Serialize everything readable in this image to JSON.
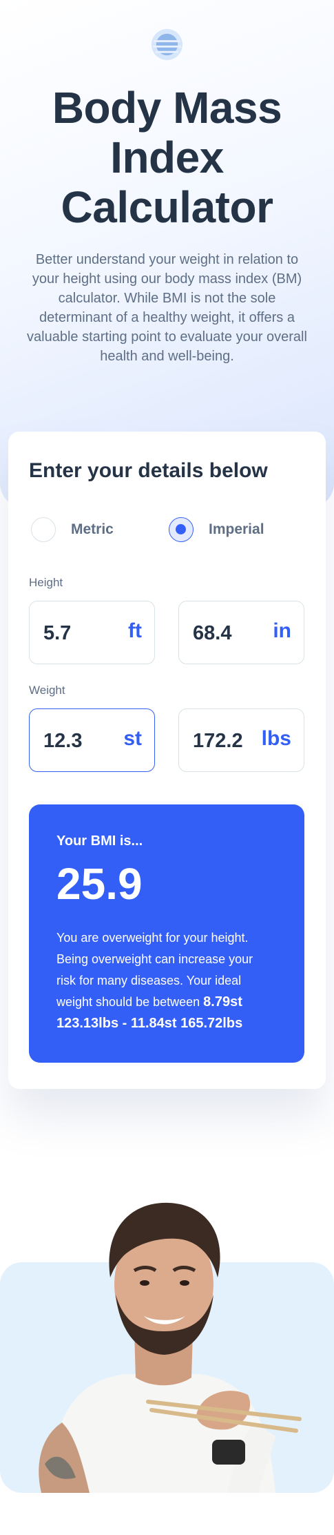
{
  "header": {
    "logo_icon": "logo-icon",
    "title": "Body Mass Index Calculator",
    "intro": "Better understand your weight in relation to your height using our body mass index (BM) calculator. While BMI is not the sole determinant of a healthy weight, it offers a valuable starting point to evaluate your overall health and well-being."
  },
  "form": {
    "heading": "Enter your details below",
    "units": [
      {
        "label": "Metric",
        "checked": false
      },
      {
        "label": "Imperial",
        "checked": true
      }
    ],
    "height": {
      "label": "Height",
      "primary": {
        "value": "5.7",
        "unit": "ft"
      },
      "secondary": {
        "value": "68.4",
        "unit": "in"
      }
    },
    "weight": {
      "label": "Weight",
      "primary": {
        "value": "12.3",
        "unit": "st"
      },
      "secondary": {
        "value": "172.2",
        "unit": "lbs"
      }
    }
  },
  "result": {
    "label": "Your BMI is...",
    "value": "25.9",
    "description": "You are overweight for your height. Being overweight can increase your risk for many diseases. Your ideal weight should be between",
    "range": "8.79st 123.13lbs - 11.84st 165.72lbs"
  },
  "colors": {
    "accent": "#345ff6",
    "heading": "#253347",
    "body": "#5e6e85",
    "border": "#d8e2e7",
    "photo_bg": "#e3f1fd"
  }
}
